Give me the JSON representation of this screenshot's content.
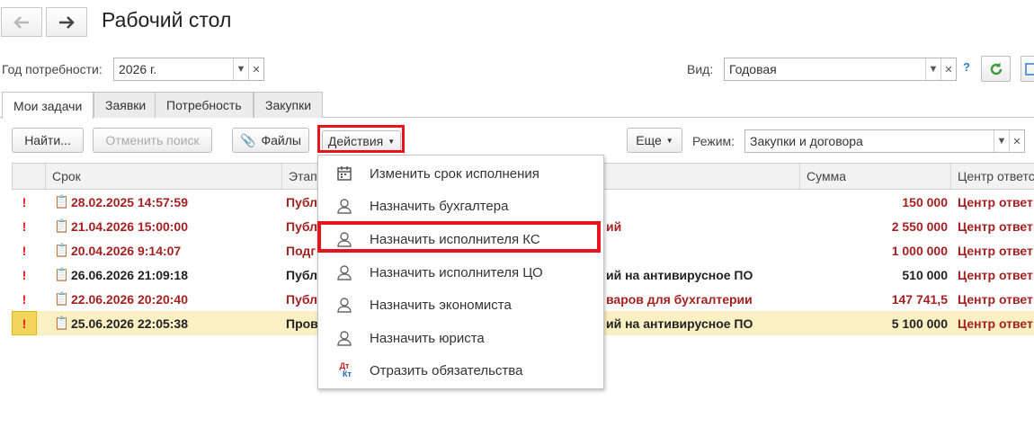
{
  "header": {
    "title": "Рабочий стол",
    "back_icon": "arrow-left-icon",
    "forward_icon": "arrow-right-icon"
  },
  "filters": {
    "year_label": "Год потребности:",
    "year_value": "2026 г.",
    "view_label": "Вид:",
    "view_value": "Годовая",
    "help": "?"
  },
  "tabs": [
    {
      "label": "Мои задачи",
      "active": true
    },
    {
      "label": "Заявки",
      "active": false
    },
    {
      "label": "Потребность",
      "active": false
    },
    {
      "label": "Закупки",
      "active": false
    }
  ],
  "toolbar": {
    "find": "Найти...",
    "cancel_search": "Отменить поиск",
    "files": "Файлы",
    "actions": "Действия",
    "more": "Еще",
    "mode_label": "Режим:",
    "mode_value": "Закупки и договора"
  },
  "table": {
    "columns": [
      "Срок",
      "Этап",
      "Сумма",
      "Центр ответс"
    ],
    "rows": [
      {
        "flag": "!",
        "date": "28.02.2025 14:57:59",
        "stage": "Публ",
        "name": "",
        "sum": "150 000",
        "center": "Центр ответ",
        "color": "red",
        "selected": false
      },
      {
        "flag": "!",
        "date": "21.04.2026 15:00:00",
        "stage": "Публ",
        "name": "ий",
        "sum": "2 550 000",
        "center": "Центр ответ",
        "color": "red",
        "selected": false
      },
      {
        "flag": "!",
        "date": "20.04.2026 9:14:07",
        "stage": "Подг",
        "name": "",
        "sum": "1 000 000",
        "center": "Центр ответ",
        "color": "red",
        "selected": false
      },
      {
        "flag": "!",
        "date": "26.06.2026 21:09:18",
        "stage": "Публ",
        "name": "ий на антивирусное ПО",
        "sum": "510 000",
        "center": "Центр ответ",
        "color": "dark",
        "selected": false
      },
      {
        "flag": "!",
        "date": "22.06.2026 20:20:40",
        "stage": "Публ",
        "name": "варов для бухгалтерии",
        "sum": "147 741,5",
        "center": "Центр ответ",
        "color": "red",
        "selected": false
      },
      {
        "flag": "!",
        "date": "25.06.2026 22:05:38",
        "stage": "Пров",
        "name": "ий на антивирусное ПО",
        "sum": "5 100 000",
        "center": "Центр ответ",
        "color": "dark",
        "selected": true
      }
    ]
  },
  "actions_menu": {
    "items": [
      {
        "label": "Изменить срок исполнения",
        "icon": "calendar-icon"
      },
      {
        "label": "Назначить бухгалтера",
        "icon": "user-icon"
      },
      {
        "label": "Назначить исполнителя КС",
        "icon": "user-icon",
        "highlighted": true
      },
      {
        "label": "Назначить исполнителя ЦО",
        "icon": "user-icon"
      },
      {
        "label": "Назначить экономиста",
        "icon": "user-icon"
      },
      {
        "label": "Назначить юриста",
        "icon": "user-icon"
      },
      {
        "label": "Отразить обязательства",
        "icon": "debit-credit-icon",
        "icon_text_top": "Дт",
        "icon_text_bottom": "Кт"
      }
    ]
  },
  "colors": {
    "accent_red": "#e8141c",
    "row_red_text": "#a52121",
    "selected_row": "#fbefc4",
    "refresh_green": "#3a9a3a"
  }
}
